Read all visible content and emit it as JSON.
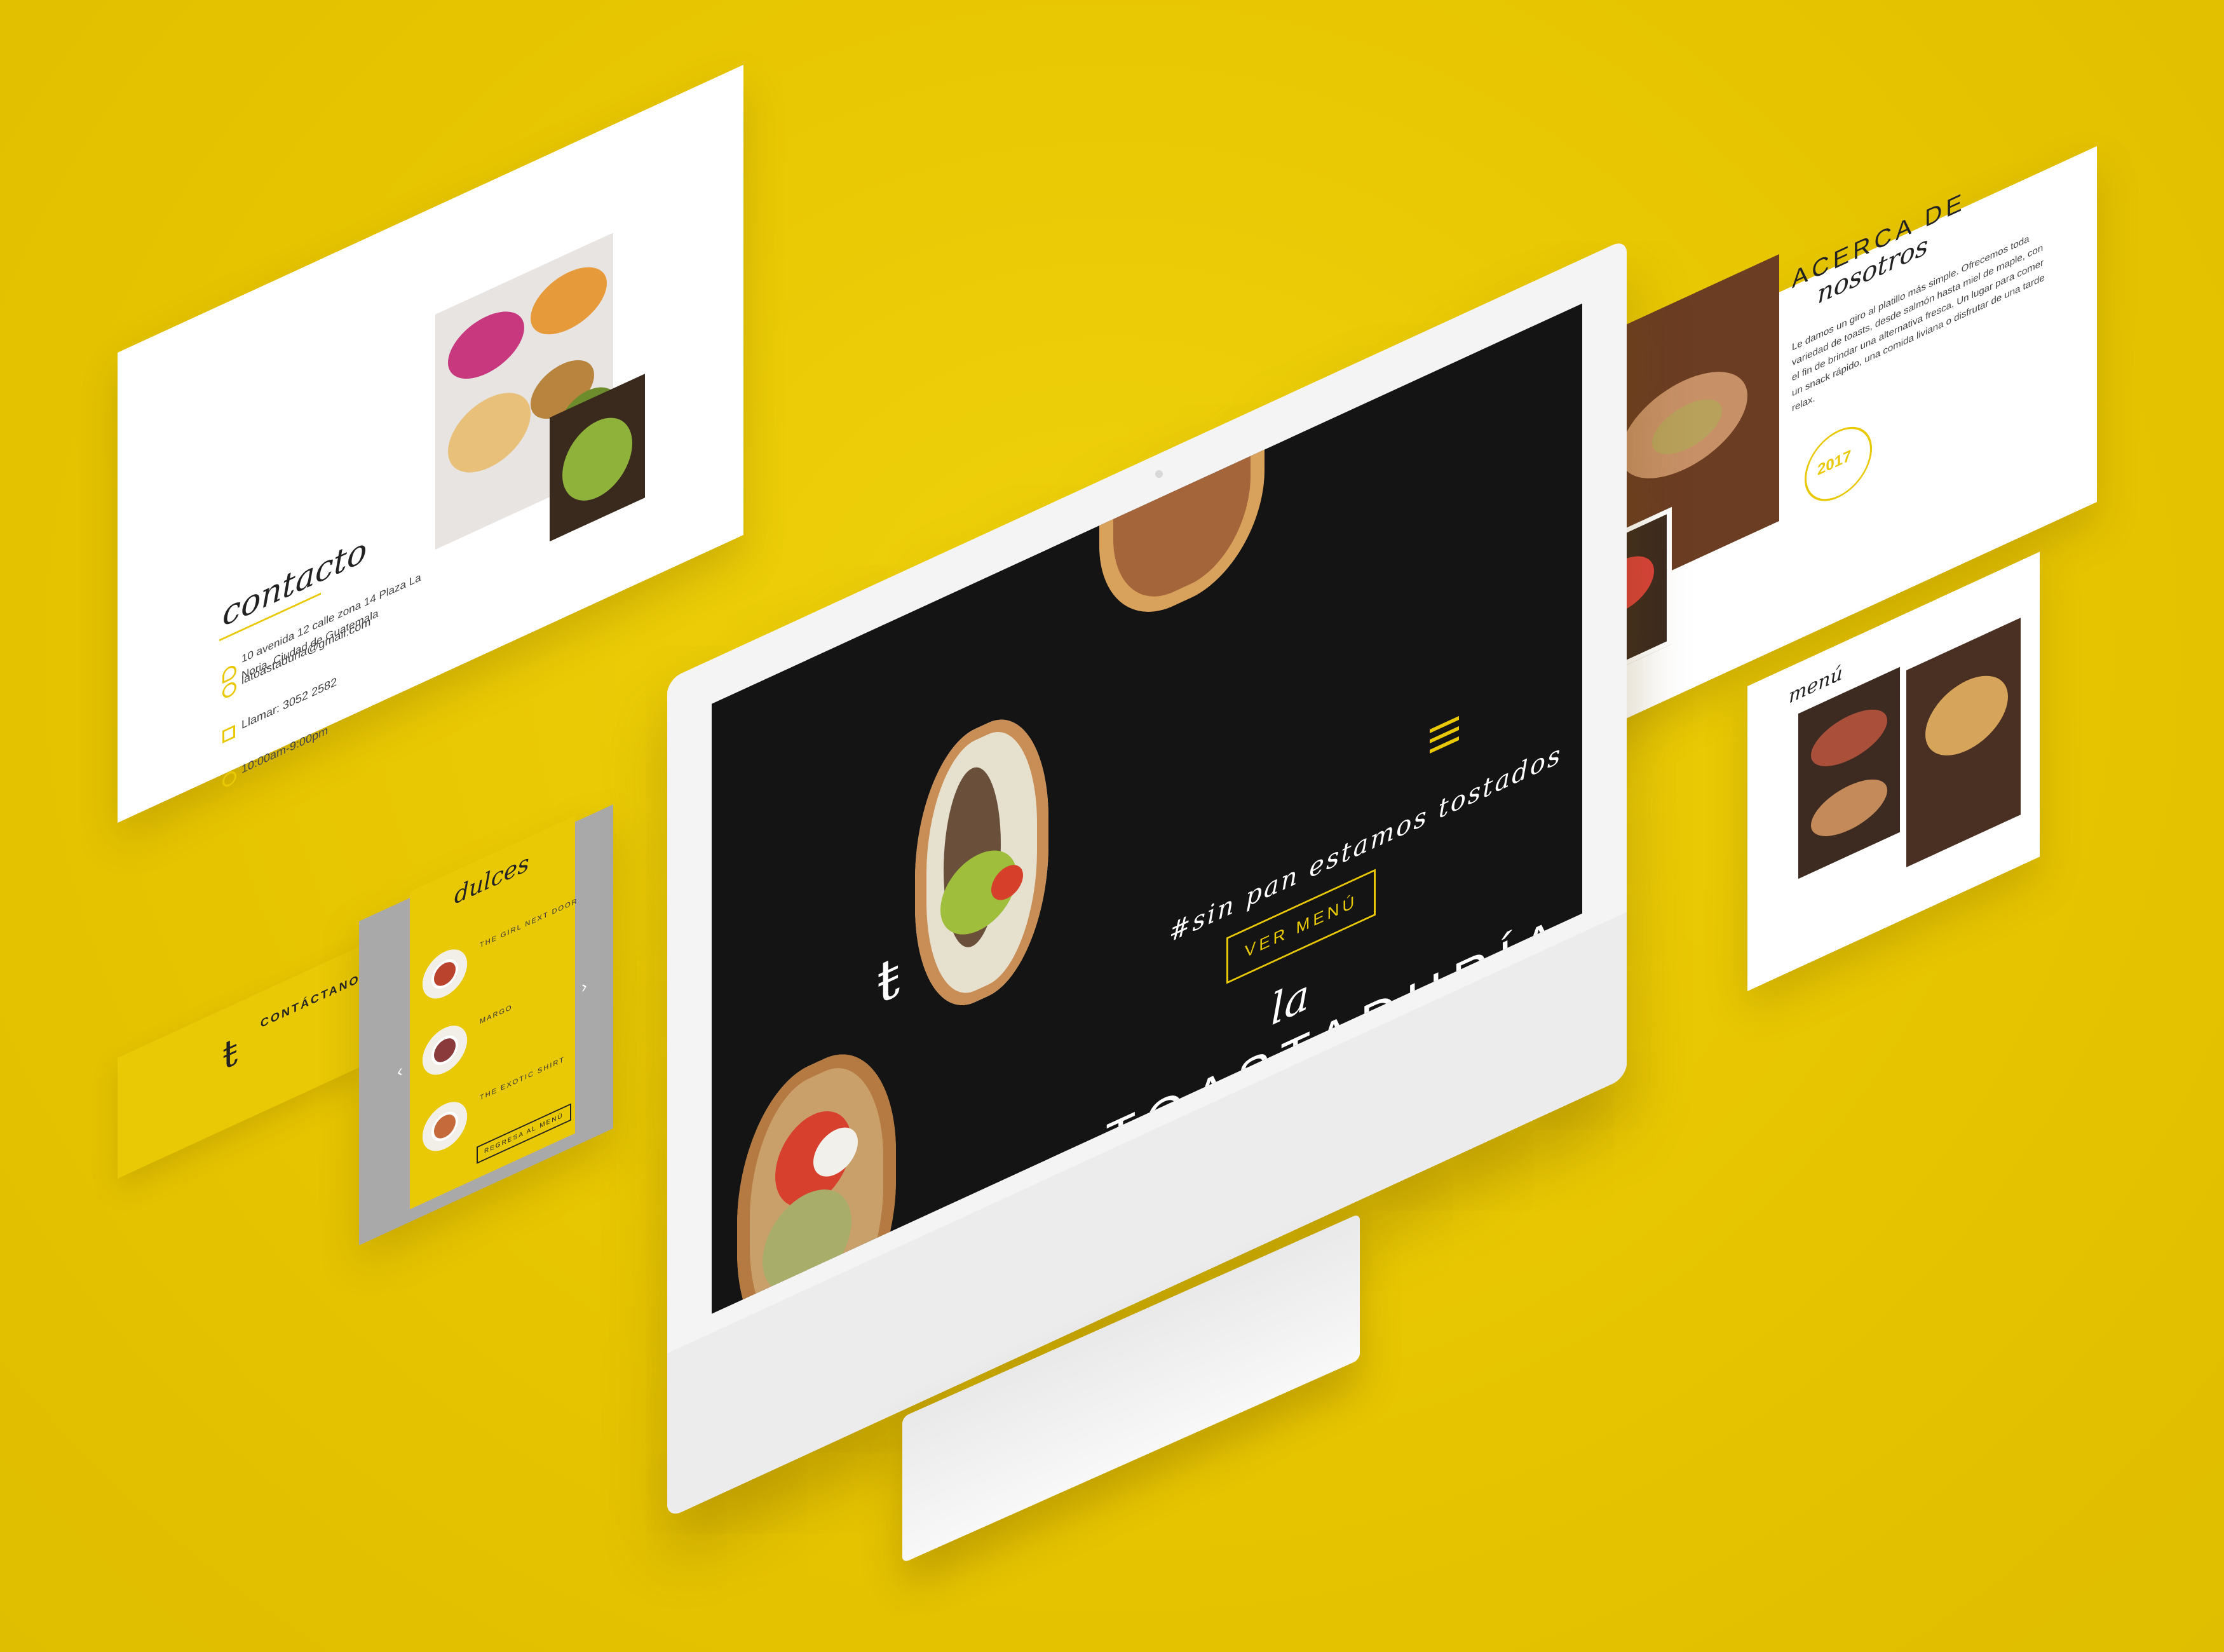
{
  "colors": {
    "brand_yellow": "#e9c805",
    "dark": "#141414",
    "white": "#ffffff"
  },
  "hero": {
    "brand_small": "la",
    "brand_big": "TOASTADURÍA",
    "tagline": "#sin pan estamos tostados",
    "cta": "VER MENÚ",
    "menu_icon": "hamburger-icon",
    "logo_icon": "t-logo-icon"
  },
  "contact": {
    "heading": "contacto",
    "address": "10 avenida 12 calle zona 14 Plaza La Noria, Ciudad de Guatemala",
    "email": "latoastaduria@gmail.com",
    "phone": "Llamar: 3052 2582",
    "hours": "10:00am-9:00pm",
    "footer_title": "CONTÁCTANOS"
  },
  "menu_panel": {
    "heading": "dulces",
    "items": [
      "THE GIRL NEXT DOOR",
      "MARGO",
      "THE EXOTIC SHIRT"
    ],
    "back_button": "REGRESA AL MENÚ"
  },
  "about": {
    "heading_top": "ACERCA DE",
    "heading_script": "nosotros",
    "body": "Le damos un giro al platillo más simple. Ofrecemos toda variedad de toasts, desde salmón hasta miel de maple, con el fin de brindar una alternativa fresca. Un lugar para comer un snack rápido, una comida liviana o disfrutar de una tarde relax.",
    "badge_year": "2017"
  },
  "menu_side": {
    "heading": "menú"
  }
}
